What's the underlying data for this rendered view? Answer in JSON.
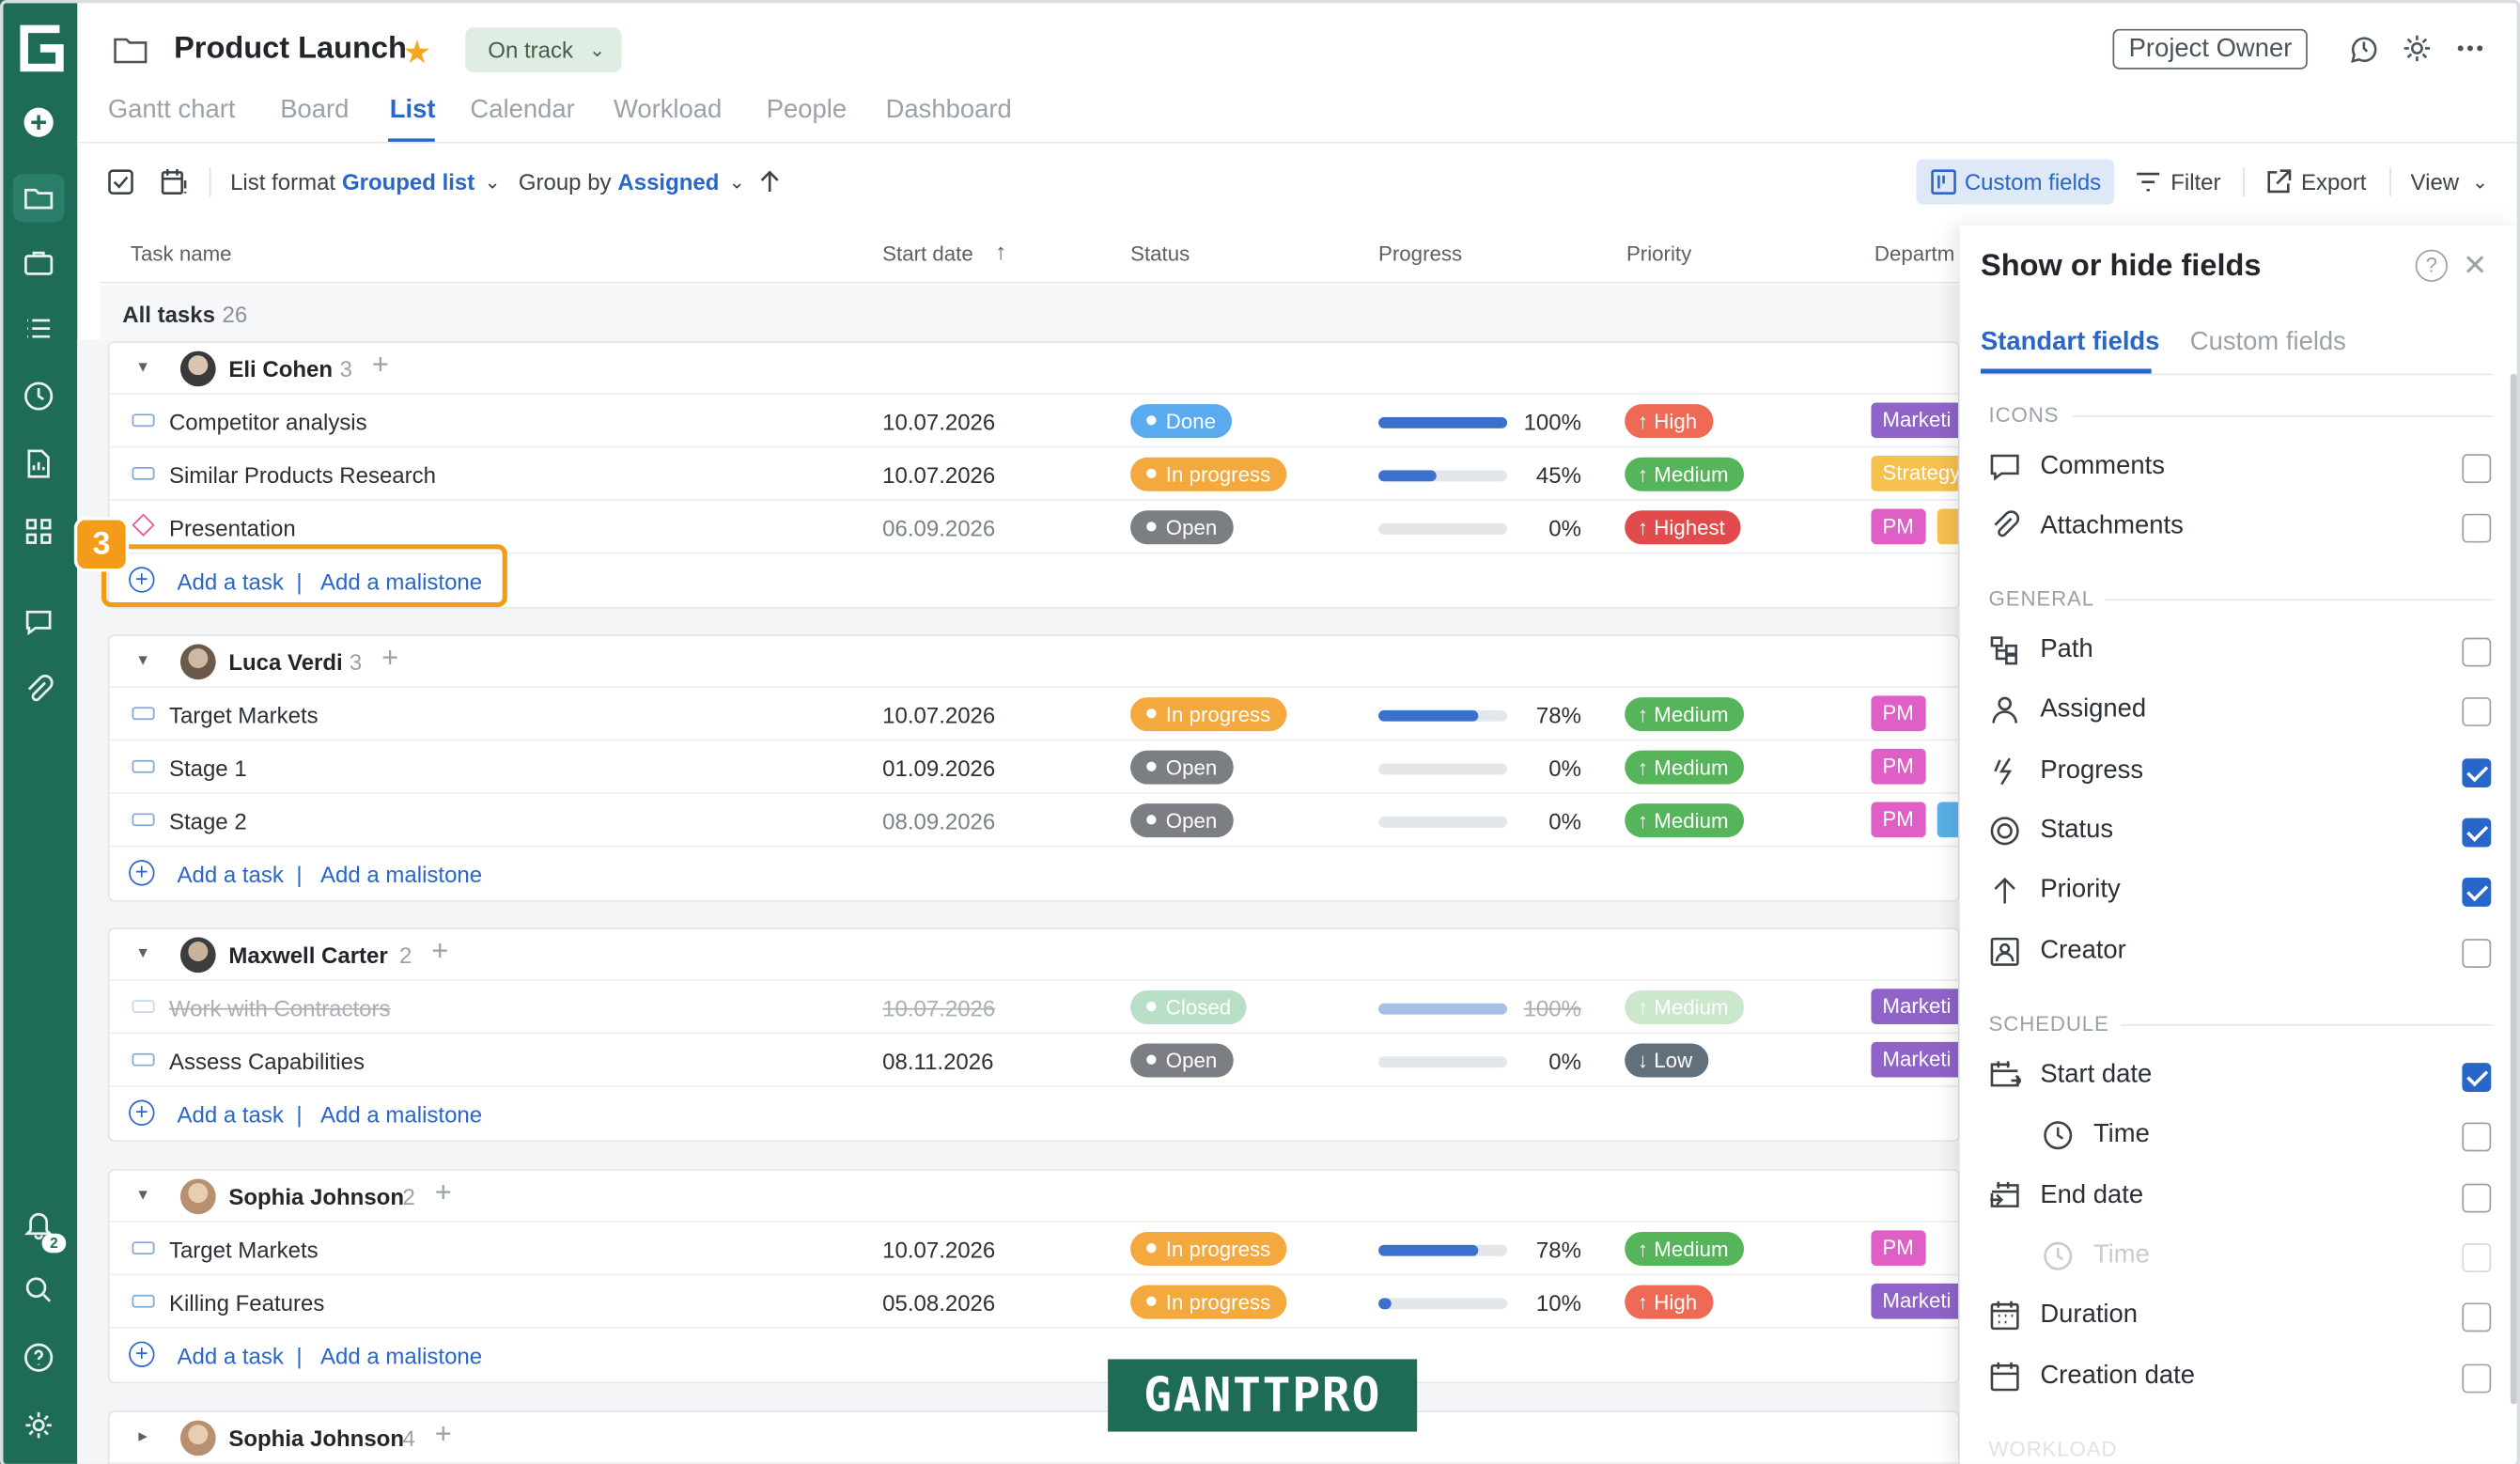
{
  "header": {
    "project_title": "Product Launch",
    "status": "On track",
    "owner_button": "Project Owner"
  },
  "tabs": [
    {
      "label": "Gantt chart"
    },
    {
      "label": "Board"
    },
    {
      "label": "List"
    },
    {
      "label": "Calendar"
    },
    {
      "label": "Workload"
    },
    {
      "label": "People"
    },
    {
      "label": "Dashboard"
    }
  ],
  "active_tab": "List",
  "toolbar": {
    "list_format_label": "List format",
    "list_format_value": "Grouped list",
    "group_by_label": "Group by",
    "group_by_value": "Assigned",
    "custom_fields": "Custom fields",
    "filter": "Filter",
    "export": "Export",
    "view": "View"
  },
  "columns": {
    "task_name": "Task name",
    "start_date": "Start date",
    "status": "Status",
    "progress": "Progress",
    "priority": "Priority",
    "department": "Departm"
  },
  "all_tasks": {
    "label": "All tasks",
    "count": "26"
  },
  "add_links": {
    "task": "Add a task",
    "separator": "|",
    "milestone": "Add a malistone"
  },
  "groups": [
    {
      "name": "Eli Cohen",
      "count": "3",
      "tasks": [
        {
          "name": "Competitor analysis",
          "start": "10.07.2026",
          "status": "Done",
          "progress": 100,
          "progress_label": "100%",
          "priority": "High",
          "dept": [
            "Marketi"
          ]
        },
        {
          "name": "Similar Products Research",
          "start": "10.07.2026",
          "status": "In progress",
          "progress": 45,
          "progress_label": "45%",
          "priority": "Medium",
          "dept": [
            "Strategy"
          ]
        },
        {
          "name": "Presentation",
          "start": "06.09.2026",
          "status": "Open",
          "progress": 0,
          "progress_label": "0%",
          "priority": "Highest",
          "dept": [
            "PM"
          ],
          "milestone": true
        }
      ]
    },
    {
      "name": "Luca Verdi",
      "count": "3",
      "tasks": [
        {
          "name": "Target Markets",
          "start": "10.07.2026",
          "status": "In progress",
          "progress": 78,
          "progress_label": "78%",
          "priority": "Medium",
          "dept": [
            "PM"
          ]
        },
        {
          "name": "Stage 1",
          "start": "01.09.2026",
          "status": "Open",
          "progress": 0,
          "progress_label": "0%",
          "priority": "Medium",
          "dept": [
            "PM"
          ]
        },
        {
          "name": "Stage 2",
          "start": "08.09.2026",
          "status": "Open",
          "progress": 0,
          "progress_label": "0%",
          "priority": "Medium",
          "dept": [
            "PM"
          ]
        }
      ]
    },
    {
      "name": "Maxwell Carter",
      "count": "2",
      "tasks": [
        {
          "name": "Work with Contractors",
          "start": "10.07.2026",
          "status": "Closed",
          "progress": 100,
          "progress_label": "100%",
          "priority": "Medium",
          "dept": [
            "Marketi"
          ],
          "closed": true
        },
        {
          "name": "Assess Capabilities",
          "start": "08.11.2026",
          "status": "Open",
          "progress": 0,
          "progress_label": "0%",
          "priority": "Low",
          "dept": [
            "Marketi"
          ]
        }
      ]
    },
    {
      "name": "Sophia Johnson",
      "count": "2",
      "tasks": [
        {
          "name": "Target Markets",
          "start": "10.07.2026",
          "status": "In progress",
          "progress": 78,
          "progress_label": "78%",
          "priority": "Medium",
          "dept": [
            "PM"
          ]
        },
        {
          "name": "Killing Features",
          "start": "05.08.2026",
          "status": "In progress",
          "progress": 10,
          "progress_label": "10%",
          "priority": "High",
          "dept": [
            "Marketi"
          ]
        }
      ]
    },
    {
      "name": "Sophia Johnson",
      "count": "4",
      "collapsed": true
    }
  ],
  "step_badge": "3",
  "watermark": "GANTTPRO",
  "rail": {
    "notification_count": "2"
  },
  "panel": {
    "title": "Show or hide fields",
    "help": "?",
    "tabs": [
      "Standart fields",
      "Custom fields"
    ],
    "sections": {
      "icons": "ICONS",
      "general": "GENERAL",
      "schedule": "SCHEDULE",
      "workload": "WORKLOAD"
    },
    "fields": [
      {
        "label": "Comments",
        "icon": "comment-icon",
        "checked": false
      },
      {
        "label": "Attachments",
        "icon": "paperclip-icon",
        "checked": false
      },
      {
        "label": "Path",
        "icon": "path-icon",
        "checked": false
      },
      {
        "label": "Assigned",
        "icon": "person-icon",
        "checked": false
      },
      {
        "label": "Progress",
        "icon": "progress-icon",
        "checked": true
      },
      {
        "label": "Status",
        "icon": "status-icon",
        "checked": true
      },
      {
        "label": "Priority",
        "icon": "arrow-up-icon",
        "checked": true
      },
      {
        "label": "Creator",
        "icon": "creator-icon",
        "checked": false
      },
      {
        "label": "Start date",
        "icon": "start-date-icon",
        "checked": true
      },
      {
        "label": "Time",
        "icon": "clock-icon",
        "checked": false
      },
      {
        "label": "End date",
        "icon": "end-date-icon",
        "checked": false
      },
      {
        "label": "Time",
        "icon": "clock-icon",
        "checked": false,
        "disabled": true
      },
      {
        "label": "Duration",
        "icon": "duration-icon",
        "checked": false
      },
      {
        "label": "Creation date",
        "icon": "calendar-icon",
        "checked": false
      }
    ]
  },
  "colors": {
    "rail": "#1e6b58",
    "accent": "#2966c9",
    "done": "#5aaaf0",
    "in_progress": "#f3a93d",
    "open": "#7b7f84",
    "high": "#ee6a55",
    "highest": "#e24b4b",
    "medium": "#56b55a",
    "low": "#62707c",
    "highlight": "#f39c1a"
  }
}
